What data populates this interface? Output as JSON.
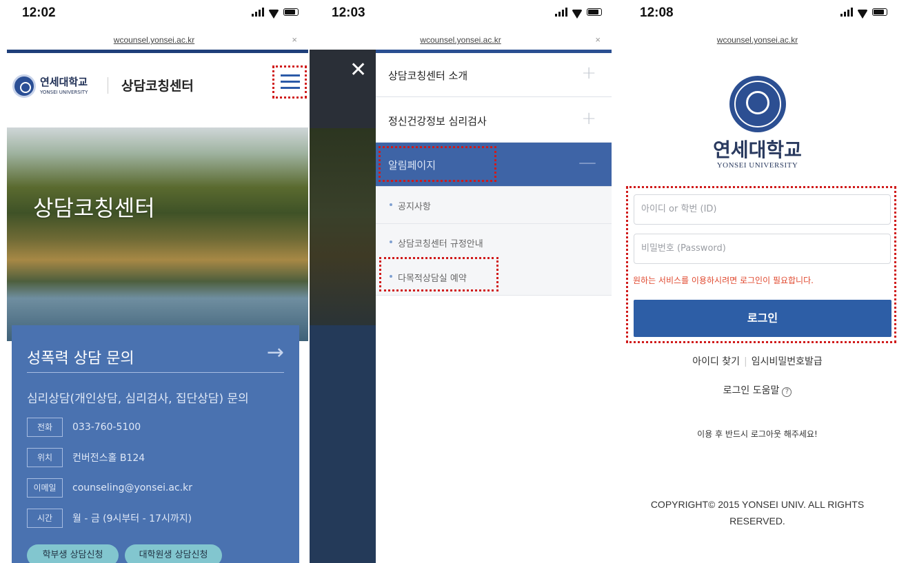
{
  "status_bars": [
    {
      "time": "12:02"
    },
    {
      "time": "12:03"
    },
    {
      "time": "12:08"
    }
  ],
  "url": "wcounsel.yonsei.ac.kr",
  "panel1": {
    "uni_name": "연세대학교",
    "uni_eng": "YONSEI UNIVERSITY",
    "site_title": "상담코칭센터",
    "hero_title": "상담코칭센터",
    "card": {
      "head": "성폭력 상담 문의",
      "subtitle": "심리상담(개인상담, 심리검사, 집단상담) 문의",
      "rows": [
        {
          "tag": "전화",
          "value": "033-760-5100"
        },
        {
          "tag": "위치",
          "value": "컨버전스홀 B124"
        },
        {
          "tag": "이메일",
          "value": "counseling@yonsei.ac.kr"
        },
        {
          "tag": "시간",
          "value": "월 - 금 (9시부터 - 17시까지)"
        }
      ],
      "btn_undergrad": "학부생 상담신청",
      "btn_grad": "대학원생 상담신청"
    }
  },
  "panel2": {
    "menu": [
      {
        "label": "상담코칭센터 소개"
      },
      {
        "label": "정신건강정보 심리검사"
      },
      {
        "label": "알림페이지"
      }
    ],
    "submenu": [
      {
        "label": "공지사항"
      },
      {
        "label": "상담코칭센터 규정안내"
      },
      {
        "label": "다목적상담실 예약"
      }
    ]
  },
  "panel3": {
    "uni_name": "연세대학교",
    "uni_eng": "YONSEI UNIVERSITY",
    "id_placeholder": "아이디 or 학번 (ID)",
    "pw_placeholder": "비밀번호 (Password)",
    "warning": "원하는 서비스를 이용하시려면 로그인이 필요합니다.",
    "login_label": "로그인",
    "find_id": "아이디 찾기",
    "temp_pw": "임시비밀번호발급",
    "help": "로그인 도움말",
    "notice": "이용 후 반드시 로그아웃 해주세요!",
    "copyright": "COPYRIGHT© 2015 YONSEI UNIV. ALL RIGHTS RESERVED."
  },
  "colors": {
    "accent": "#2d5ea6",
    "highlight": "#d01a1a",
    "card": "#4a72b0"
  }
}
